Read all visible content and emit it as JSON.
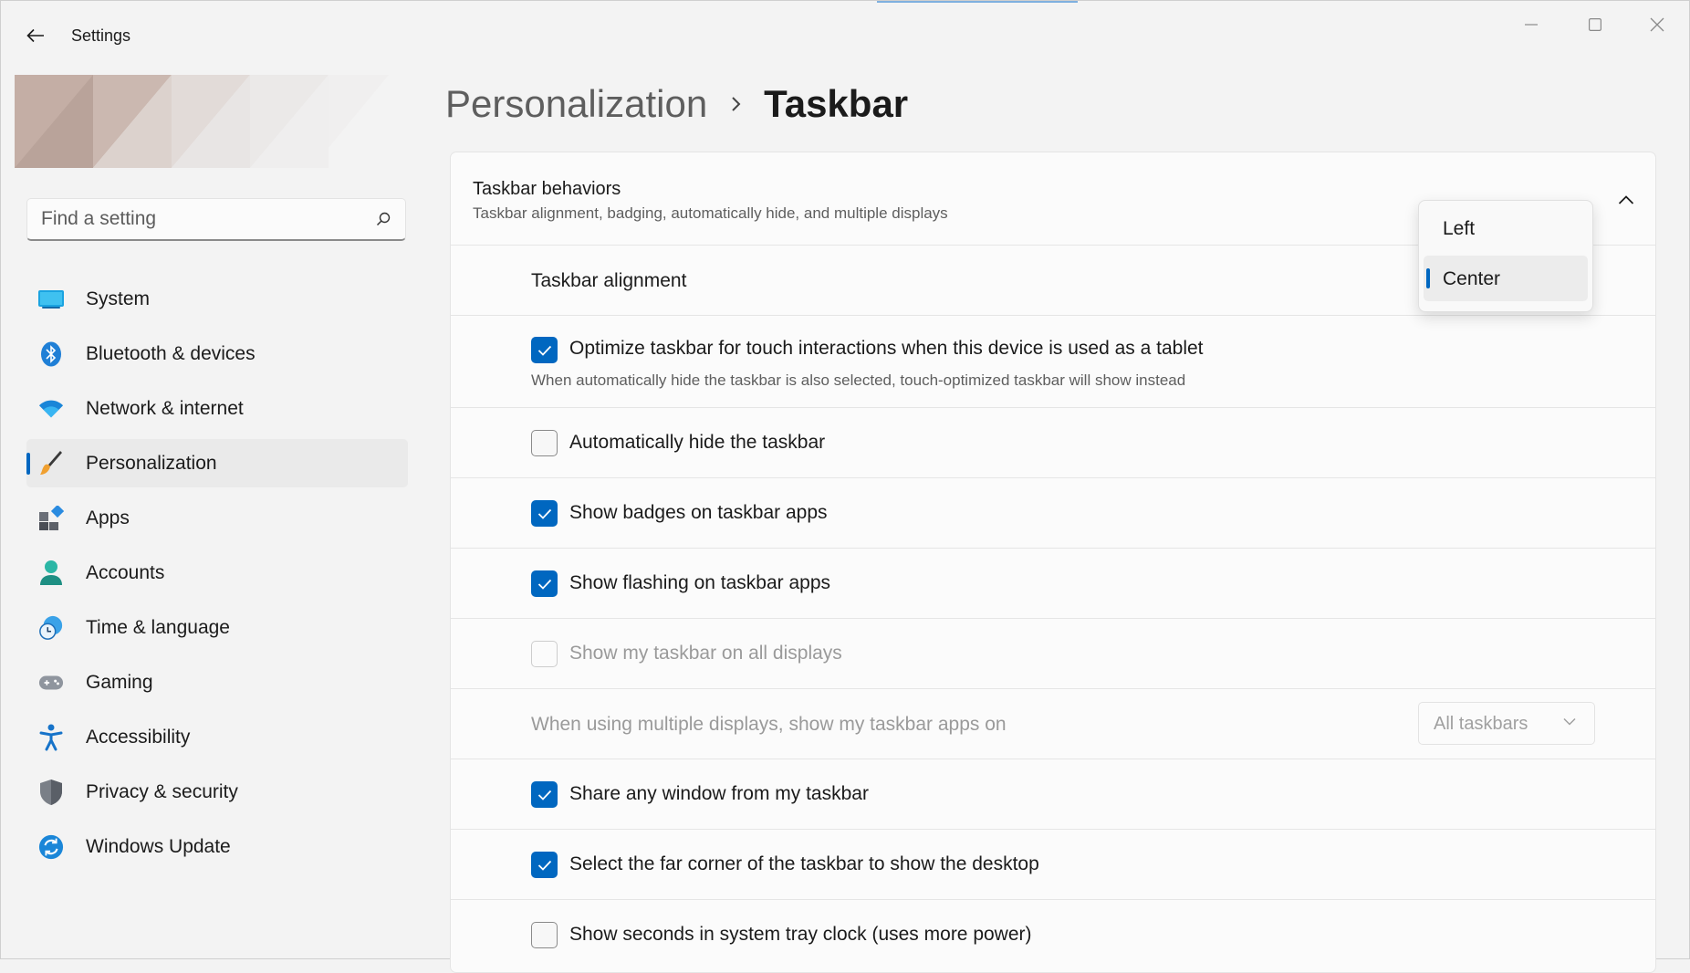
{
  "app": {
    "title": "Settings"
  },
  "search": {
    "placeholder": "Find a setting"
  },
  "sidebar": {
    "items": [
      {
        "label": "System",
        "icon": "system-icon"
      },
      {
        "label": "Bluetooth & devices",
        "icon": "bluetooth-icon"
      },
      {
        "label": "Network & internet",
        "icon": "wifi-icon"
      },
      {
        "label": "Personalization",
        "icon": "brush-icon",
        "active": true
      },
      {
        "label": "Apps",
        "icon": "apps-icon"
      },
      {
        "label": "Accounts",
        "icon": "account-icon"
      },
      {
        "label": "Time & language",
        "icon": "globe-clock-icon"
      },
      {
        "label": "Gaming",
        "icon": "gamepad-icon"
      },
      {
        "label": "Accessibility",
        "icon": "accessibility-icon"
      },
      {
        "label": "Privacy & security",
        "icon": "shield-icon"
      },
      {
        "label": "Windows Update",
        "icon": "update-icon"
      }
    ]
  },
  "header": {
    "parent": "Personalization",
    "current": "Taskbar"
  },
  "group": {
    "title": "Taskbar behaviors",
    "description": "Taskbar alignment, badging, automatically hide, and multiple displays"
  },
  "settings": {
    "alignment_label": "Taskbar alignment",
    "touch": {
      "label": "Optimize taskbar for touch interactions when this device is used as a tablet",
      "sub": "When automatically hide the taskbar is also selected, touch-optimized taskbar will show instead",
      "checked": true
    },
    "autohide": {
      "label": "Automatically hide the taskbar",
      "checked": false
    },
    "badges": {
      "label": "Show badges on taskbar apps",
      "checked": true
    },
    "flashing": {
      "label": "Show flashing on taskbar apps",
      "checked": true
    },
    "all_displays": {
      "label": "Show my taskbar on all displays",
      "checked": false,
      "disabled": true
    },
    "multi_display": {
      "label": "When using multiple displays, show my taskbar apps on",
      "value": "All taskbars",
      "disabled": true
    },
    "share_window": {
      "label": "Share any window from my taskbar",
      "checked": true
    },
    "far_corner": {
      "label": "Select the far corner of the taskbar to show the desktop",
      "checked": true
    },
    "seconds": {
      "label": "Show seconds in system tray clock (uses more power)",
      "checked": false
    }
  },
  "alignment_dropdown": {
    "options": [
      "Left",
      "Center"
    ],
    "selected": "Center"
  },
  "colors": {
    "accent": "#0067c0",
    "background": "#f3f3f3",
    "card": "#fbfbfb"
  }
}
